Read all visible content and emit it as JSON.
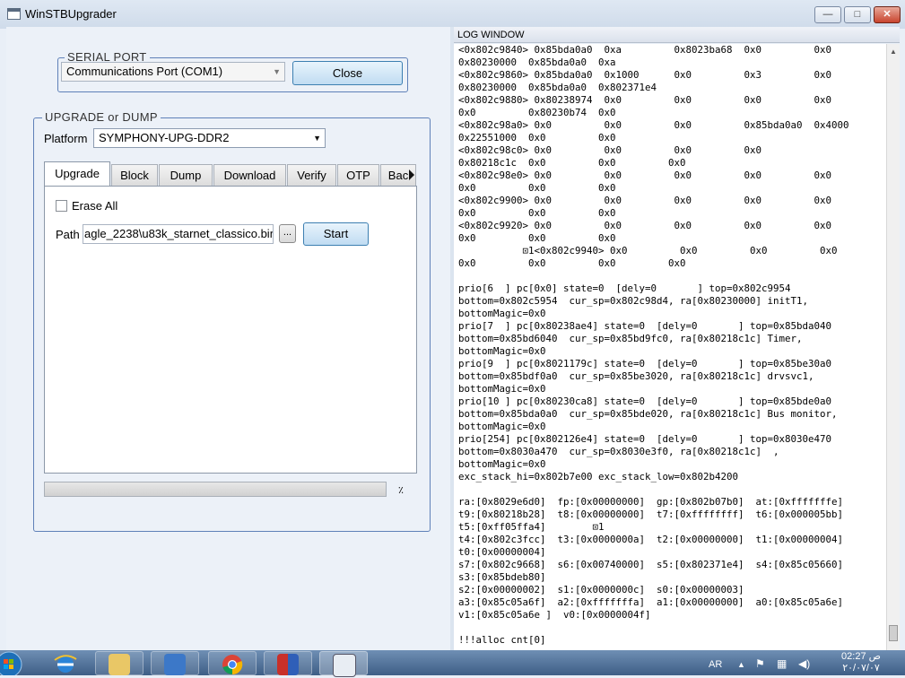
{
  "window": {
    "title": "WinSTBUpgrader",
    "minimize": "—",
    "maximize": "□",
    "close": "✕"
  },
  "serial_port": {
    "legend": "SERIAL PORT",
    "port_value": "Communications Port (COM1)",
    "close_button": "Close"
  },
  "upgrade_dump": {
    "legend": "UPGRADE or DUMP",
    "platform_label": "Platform",
    "platform_value": "SYMPHONY-UPG-DDR2",
    "tabs": [
      "Upgrade",
      "Block",
      "Dump",
      "Download",
      "Verify",
      "OTP",
      "Bac"
    ],
    "active_tab": "Upgrade",
    "erase_all_label": "Erase All",
    "erase_all_checked": false,
    "path_label": "Path",
    "path_value": "agle_2238\\u83k_starnet_classico.bin",
    "browse_button": "...",
    "start_button": "Start",
    "progress_percent": 0,
    "progress_text": "٪"
  },
  "log": {
    "title": "LOG WINDOW",
    "lines": [
      "<0x802c9840> 0x85bda0a0  0xa         0x8023ba68  0x0         0x0",
      "0x80230000  0x85bda0a0  0xa",
      "<0x802c9860> 0x85bda0a0  0x1000      0x0         0x3         0x0",
      "0x80230000  0x85bda0a0  0x802371e4",
      "<0x802c9880> 0x80238974  0x0         0x0         0x0         0x0",
      "0x0         0x80230b74  0x0",
      "<0x802c98a0> 0x0         0x0         0x0         0x85bda0a0  0x4000",
      "0x22551000  0x0         0x0",
      "<0x802c98c0> 0x0         0x0         0x0         0x0",
      "0x80218c1c  0x0         0x0         0x0",
      "<0x802c98e0> 0x0         0x0         0x0         0x0         0x0",
      "0x0         0x0         0x0",
      "<0x802c9900> 0x0         0x0         0x0         0x0         0x0",
      "0x0         0x0         0x0",
      "<0x802c9920> 0x0         0x0         0x0         0x0         0x0",
      "0x0         0x0         0x0",
      "           ⊡1<0x802c9940> 0x0         0x0         0x0         0x0",
      "0x0         0x0         0x0         0x0",
      "",
      "prio[6  ] pc[0x0] state=0  [dely=0       ] top=0x802c9954",
      "bottom=0x802c5954  cur_sp=0x802c98d4, ra[0x80230000] initT1,",
      "bottomMagic=0x0",
      "prio[7  ] pc[0x80238ae4] state=0  [dely=0       ] top=0x85bda040",
      "bottom=0x85bd6040  cur_sp=0x85bd9fc0, ra[0x80218c1c] Timer,",
      "bottomMagic=0x0",
      "prio[9  ] pc[0x8021179c] state=0  [dely=0       ] top=0x85be30a0",
      "bottom=0x85bdf0a0  cur_sp=0x85be3020, ra[0x80218c1c] drvsvc1,",
      "bottomMagic=0x0",
      "prio[10 ] pc[0x80230ca8] state=0  [dely=0       ] top=0x85bde0a0",
      "bottom=0x85bda0a0  cur_sp=0x85bde020, ra[0x80218c1c] Bus monitor,",
      "bottomMagic=0x0",
      "prio[254] pc[0x802126e4] state=0  [dely=0       ] top=0x8030e470",
      "bottom=0x8030a470  cur_sp=0x8030e3f0, ra[0x80218c1c]  ,",
      "bottomMagic=0x0",
      "exc_stack_hi=0x802b7e00 exc_stack_low=0x802b4200",
      "",
      "ra:[0x8029e6d0]  fp:[0x00000000]  gp:[0x802b07b0]  at:[0xfffffffe]",
      "t9:[0x80218b28]  t8:[0x00000000]  t7:[0xffffffff]  t6:[0x000005bb]",
      "t5:[0xff05ffa4]        ⊡1",
      "t4:[0x802c3fcc]  t3:[0x0000000a]  t2:[0x00000000]  t1:[0x00000004]",
      "t0:[0x00000004]",
      "s7:[0x802c9668]  s6:[0x00740000]  s5:[0x802371e4]  s4:[0x85c05660]",
      "s3:[0x85bdeb80]",
      "s2:[0x00000002]  s1:[0x0000000c]  s0:[0x00000003]",
      "a3:[0x85c05a6f]  a2:[0xfffffffa]  a1:[0x00000000]  a0:[0x85c05a6e]",
      "v1:[0x85c05a6e ]  v0:[0x0000004f]",
      "",
      "!!!alloc cnt[0]"
    ]
  },
  "taskbar": {
    "language": "AR",
    "time": "02:27",
    "ampm": "ص",
    "date": "٢٠/٠٧/٠٧"
  }
}
